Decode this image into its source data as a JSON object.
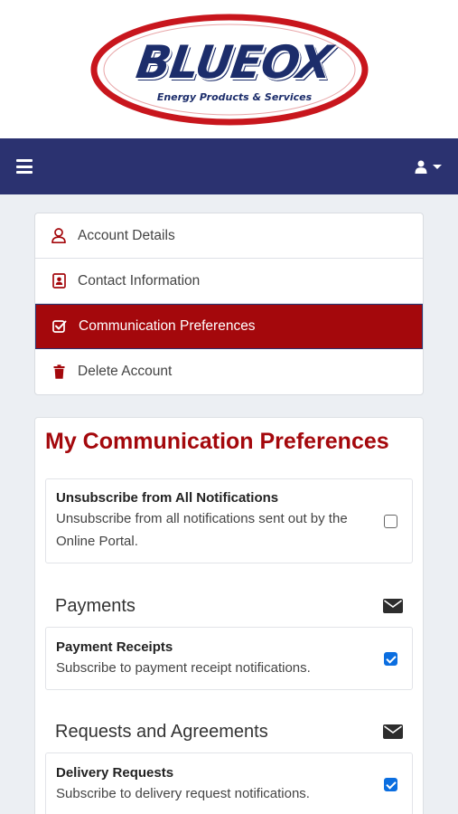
{
  "brand": {
    "name": "BLUEOX",
    "tagline": "Energy Products & Services",
    "primary_color": "#2b3270",
    "accent_color": "#a4080c"
  },
  "navbar": {
    "menu_icon": "hamburger-icon",
    "user_icon": "user-icon"
  },
  "account_menu": {
    "items": [
      {
        "label": "Account Details",
        "icon": "user-outline-icon",
        "active": false
      },
      {
        "label": "Contact Information",
        "icon": "contact-card-icon",
        "active": false
      },
      {
        "label": "Communication Preferences",
        "icon": "checkbox-icon",
        "active": true
      },
      {
        "label": "Delete Account",
        "icon": "trash-icon",
        "active": false
      }
    ]
  },
  "preferences": {
    "title": "My Communication Preferences",
    "unsubscribe_all": {
      "title": "Unsubscribe from All Notifications",
      "description": "Unsubscribe from all notifications sent out by the Online Portal.",
      "checked": false
    },
    "sections": [
      {
        "title": "Payments",
        "icon": "envelope-icon",
        "options": [
          {
            "title": "Payment Receipts",
            "description": "Subscribe to payment receipt notifications.",
            "checked": true
          }
        ]
      },
      {
        "title": "Requests and Agreements",
        "icon": "envelope-icon",
        "options": [
          {
            "title": "Delivery Requests",
            "description": "Subscribe to delivery request notifications.",
            "checked": true
          }
        ]
      }
    ]
  }
}
